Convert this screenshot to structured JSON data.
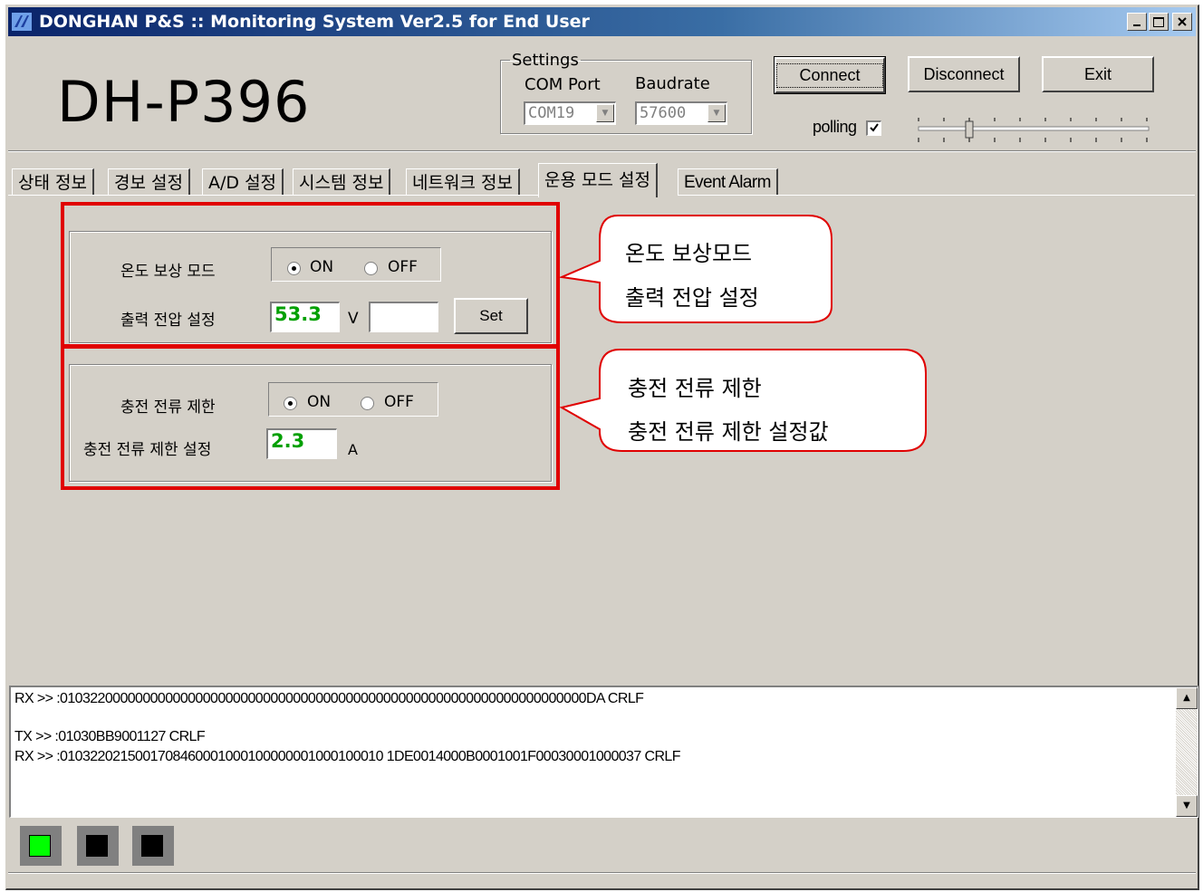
{
  "window": {
    "title": "DONGHAN P&S :: Monitoring System Ver2.5 for End User",
    "minimize": "_",
    "maximize": "□",
    "close": "×"
  },
  "header": {
    "model": "DH-P396",
    "settings": {
      "legend": "Settings",
      "com_port_label": "COM Port",
      "baudrate_label": "Baudrate",
      "com_port_value": "COM19",
      "baudrate_value": "57600"
    },
    "buttons": {
      "connect": "Connect",
      "disconnect": "Disconnect",
      "exit": "Exit"
    },
    "polling_label": "polling",
    "polling_checked": true
  },
  "tabs": [
    {
      "label": "상태 정보",
      "active": false
    },
    {
      "label": "경보 설정",
      "active": false
    },
    {
      "label": "A/D 설정",
      "active": false
    },
    {
      "label": "시스템 정보",
      "active": false
    },
    {
      "label": "네트워크 정보",
      "active": false
    },
    {
      "label": "운용 모드 설정",
      "active": true
    },
    {
      "label": "Event Alarm",
      "active": false
    }
  ],
  "temp_group": {
    "mode_label": "온도 보상 모드",
    "on_label": "ON",
    "off_label": "OFF",
    "selected": "ON",
    "voltage_label": "출력 전압 설정",
    "voltage_value": "53.3",
    "voltage_unit": "V",
    "voltage_input": "",
    "set_button": "Set"
  },
  "charge_group": {
    "limit_label": "충전 전류 제한",
    "on_label": "ON",
    "off_label": "OFF",
    "selected": "ON",
    "setting_label": "충전 전류 제한 설정",
    "setting_value": "2.3",
    "setting_unit": "A"
  },
  "callouts": [
    {
      "line1": "온도 보상모드",
      "line2": "출력 전압 설정"
    },
    {
      "line1": "충전 전류 제한",
      "line2": "충전 전류 제한 설정값"
    }
  ],
  "log": {
    "lines": [
      "RX >> :0103220000000000000000000000000000000000000000000000000000000000000000DA CRLF",
      "",
      "TX >> :01030BB9001127 CRLF",
      "RX >> :0103220215001708460001000100000001000100010 1DE0014000B0001001F00030001000037 CRLF"
    ]
  },
  "indicators": [
    {
      "name": "led-1",
      "color": "#00ff00"
    },
    {
      "name": "led-2",
      "color": "#000000"
    },
    {
      "name": "led-3",
      "color": "#000000"
    }
  ],
  "colors": {
    "title_bar": "#0a246a",
    "window_bg": "#d4d0c8",
    "highlight_box": "#e00000",
    "value_text": "#00a000"
  }
}
